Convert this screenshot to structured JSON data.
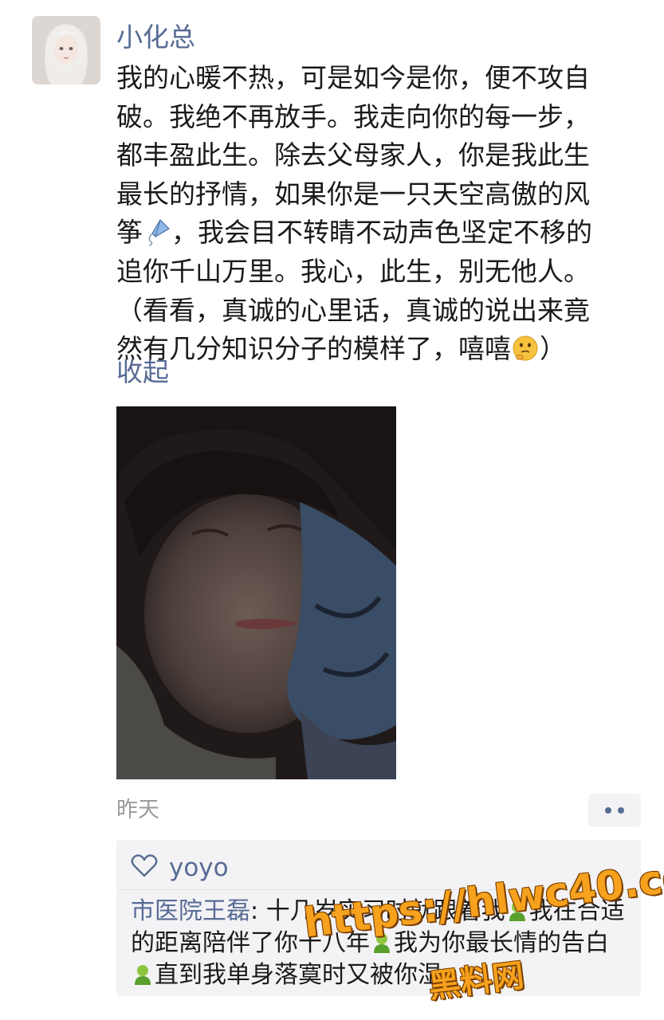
{
  "post": {
    "author": "小化总",
    "body_lines": [
      "我的心暖不热，可是如今是你，便不攻自",
      "破。我绝不再放手。我走向你的每一步，",
      "都丰盈此生。除去父母家人，你是我此生",
      "最长的抒情，如果你是一只天空高傲的风",
      "，我会目不转睛不动声色坚定不移的",
      "追你千山万里。我心，此生，别无他人。",
      "（看看，真诚的心里话，真诚的说出来竟",
      "然有几分知识分子的模样了，嘻嘻"
    ],
    "body_line5_prefix": "筝",
    "body_line8_suffix": "）",
    "kite_emoji": "kite-emoji",
    "thinking_emoji": "thinking-face-emoji",
    "collapse_label": "收起",
    "timestamp": "昨天"
  },
  "interactions": {
    "likes": "yoyo",
    "comment": {
      "author": "市医院王磊",
      "separator": ": ",
      "line1": "十几岁实习时就跟着我",
      "line1_tail": "我在合适",
      "line2": "的距离陪伴了你十八年",
      "line2_tail": "我为你最长情的告白",
      "line3": "直到我单身落寞时又被你湿"
    }
  },
  "watermark": {
    "url": "https://hlwc40.com",
    "name": "黑料网"
  },
  "colors": {
    "link": "#576b95",
    "muted": "#9b9b9b",
    "panel": "#f3f3f5",
    "watermark": "#f6a21e"
  }
}
